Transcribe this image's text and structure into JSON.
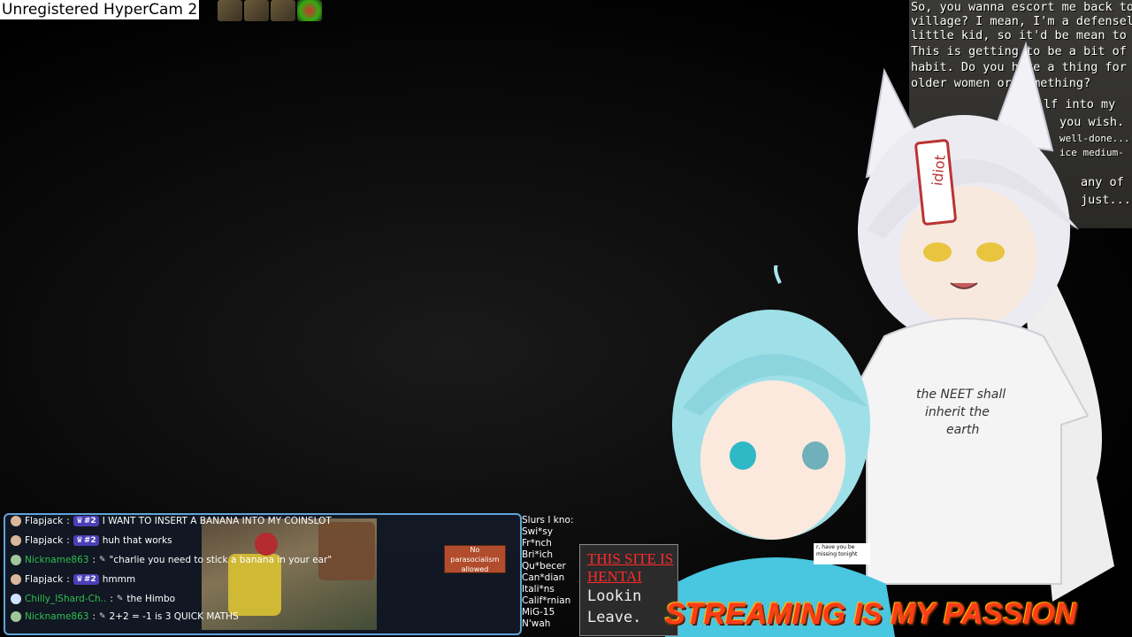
{
  "watermark": {
    "text": "Unregistered HyperCam 2"
  },
  "dialog": {
    "lines": [
      "So, you wanna escort me back to the",
      "village? I mean, I'm a defenseless",
      "little kid, so it'd be mean to say no!",
      "This is getting to be a bit of a",
      "habit. Do you have a thing for",
      "older women or something?",
      "lf into my",
      "you wish.",
      "well-done...",
      "ice medium-",
      "any of",
      "just..."
    ]
  },
  "chat": {
    "messages": [
      {
        "user": "Flapjack",
        "badge": "#2",
        "text": "I WANT TO INSERT A BANANA INTO MY COINSLOT",
        "name_color": "white"
      },
      {
        "user": "Flapjack",
        "badge": "#2",
        "text": "huh that works",
        "name_color": "white"
      },
      {
        "user": "Nickname863",
        "badge": "",
        "text": "\"charlie you need to stick a banana in your ear\"",
        "name_color": "green"
      },
      {
        "user": "Flapjack",
        "badge": "#2",
        "text": "hmmm",
        "name_color": "white"
      },
      {
        "user": "Chilly_IShard-Ch..",
        "badge": "",
        "text": "the Himbo",
        "name_color": "green"
      },
      {
        "user": "Nickname863",
        "badge": "",
        "text": "2+2 = -1 is 3 QUICK MATHS",
        "name_color": "green"
      }
    ],
    "sign": "No parasocialism allowed"
  },
  "slurs": [
    "Slurs I kno:",
    "Swi*sy",
    "Fr*nch",
    "Bri*ich",
    "Qu*becer",
    "Can*dian",
    "Itali*ns",
    "Calif*rnian",
    "MiG-15",
    "N'wah"
  ],
  "site": {
    "red_lines": [
      "THIS SITE IS",
      "HENTAI"
    ],
    "gray_lines": [
      "Lookin",
      "Leave."
    ]
  },
  "speech": "r, have you be missing tonight",
  "fox_shirt": [
    "the NEET shall",
    "inherit the",
    "earth"
  ],
  "fox_tag": "idiot",
  "banner": "STREAMING IS MY PASSION"
}
